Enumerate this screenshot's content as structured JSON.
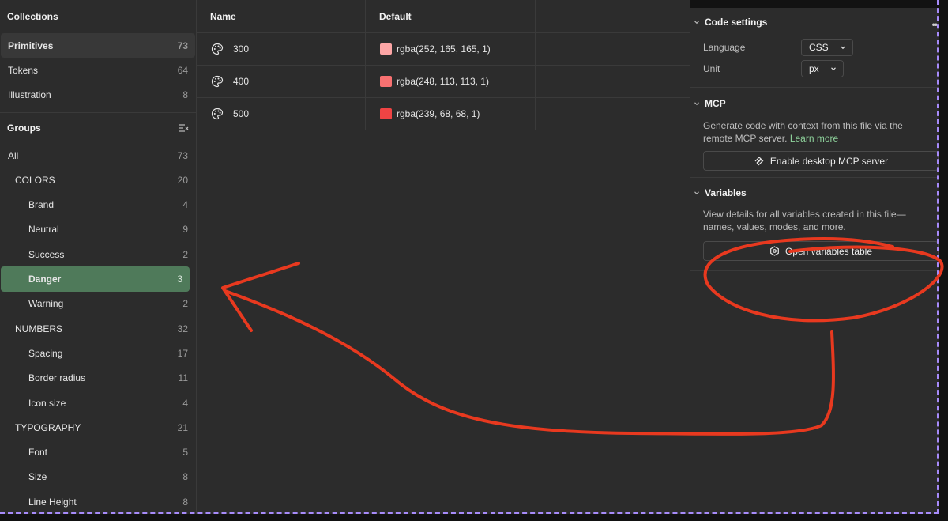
{
  "collections": {
    "title": "Collections",
    "items": [
      {
        "label": "Primitives",
        "count": "73"
      },
      {
        "label": "Tokens",
        "count": "64"
      },
      {
        "label": "Illustration",
        "count": "8"
      }
    ]
  },
  "groups": {
    "title": "Groups",
    "items": [
      {
        "label": "All",
        "count": "73"
      },
      {
        "label": "COLORS",
        "count": "20"
      },
      {
        "label": "Brand",
        "count": "4"
      },
      {
        "label": "Neutral",
        "count": "9"
      },
      {
        "label": "Success",
        "count": "2"
      },
      {
        "label": "Danger",
        "count": "3"
      },
      {
        "label": "Warning",
        "count": "2"
      },
      {
        "label": "NUMBERS",
        "count": "32"
      },
      {
        "label": "Spacing",
        "count": "17"
      },
      {
        "label": "Border radius",
        "count": "11"
      },
      {
        "label": "Icon size",
        "count": "4"
      },
      {
        "label": "TYPOGRAPHY",
        "count": "21"
      },
      {
        "label": "Font",
        "count": "5"
      },
      {
        "label": "Size",
        "count": "8"
      },
      {
        "label": "Line Height",
        "count": "8"
      }
    ]
  },
  "table": {
    "headers": {
      "name": "Name",
      "default": "Default"
    },
    "rows": [
      {
        "name": "300",
        "value": "rgba(252, 165, 165, 1)",
        "swatch": "#fca5a5"
      },
      {
        "name": "400",
        "value": "rgba(248, 113, 113, 1)",
        "swatch": "#f87171"
      },
      {
        "name": "500",
        "value": "rgba(239, 68, 68, 1)",
        "swatch": "#ef4444"
      }
    ]
  },
  "right_panel": {
    "code_settings": {
      "title": "Code settings",
      "language_label": "Language",
      "language_value": "CSS",
      "unit_label": "Unit",
      "unit_value": "px"
    },
    "mcp": {
      "title": "MCP",
      "desc": "Generate code with context from this file via the remote MCP server.",
      "link": "Learn more",
      "button": "Enable desktop MCP server"
    },
    "variables": {
      "title": "Variables",
      "desc": "View details for all variables created in this file—names, values, modes, and more.",
      "button": "Open variables table"
    }
  },
  "colors": {
    "selected_group": "#4f7a5a",
    "annotation": "#e8391f",
    "link": "#8ed29b",
    "window_dash": "#a78bfa"
  }
}
